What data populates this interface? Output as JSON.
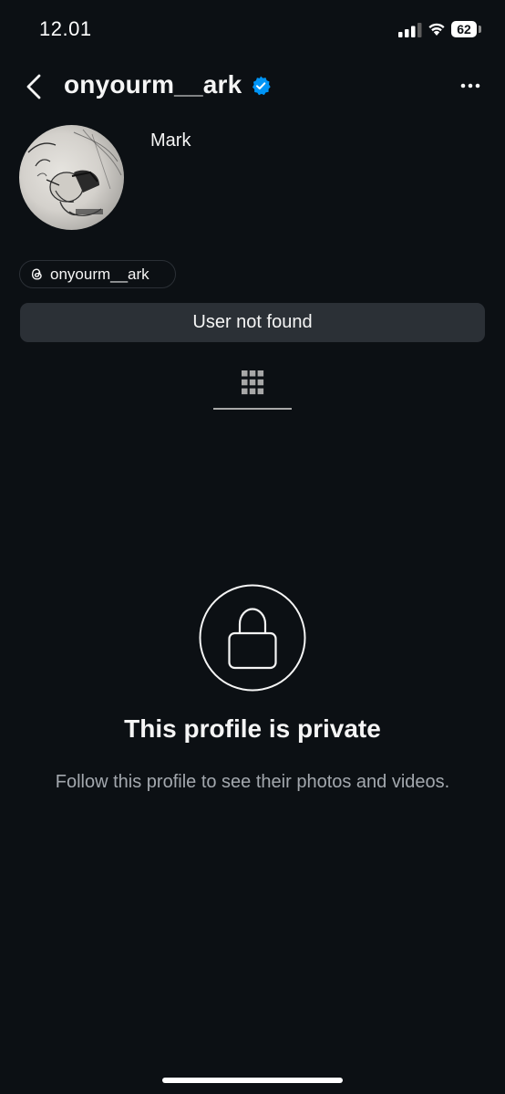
{
  "status_bar": {
    "time": "12.01",
    "battery": "62",
    "icons": [
      "cellular-signal-icon",
      "wifi-icon",
      "battery-icon"
    ]
  },
  "header": {
    "username": "onyourm__ark",
    "verified": true,
    "icons": [
      "chevron-left-icon",
      "verified-badge-icon",
      "more-horizontal-icon"
    ]
  },
  "profile": {
    "display_name": "Mark",
    "threads_handle": "onyourm__ark"
  },
  "actions": {
    "user_not_found_label": "User not found"
  },
  "tabs": {
    "active": "grid-icon"
  },
  "private": {
    "title": "This profile is private",
    "subtitle": "Follow this profile to see their photos and videos."
  },
  "colors": {
    "background": "#0c1014",
    "button": "#2b3036",
    "verified_blue": "#0095f6",
    "muted_text": "#a3a8ae"
  }
}
